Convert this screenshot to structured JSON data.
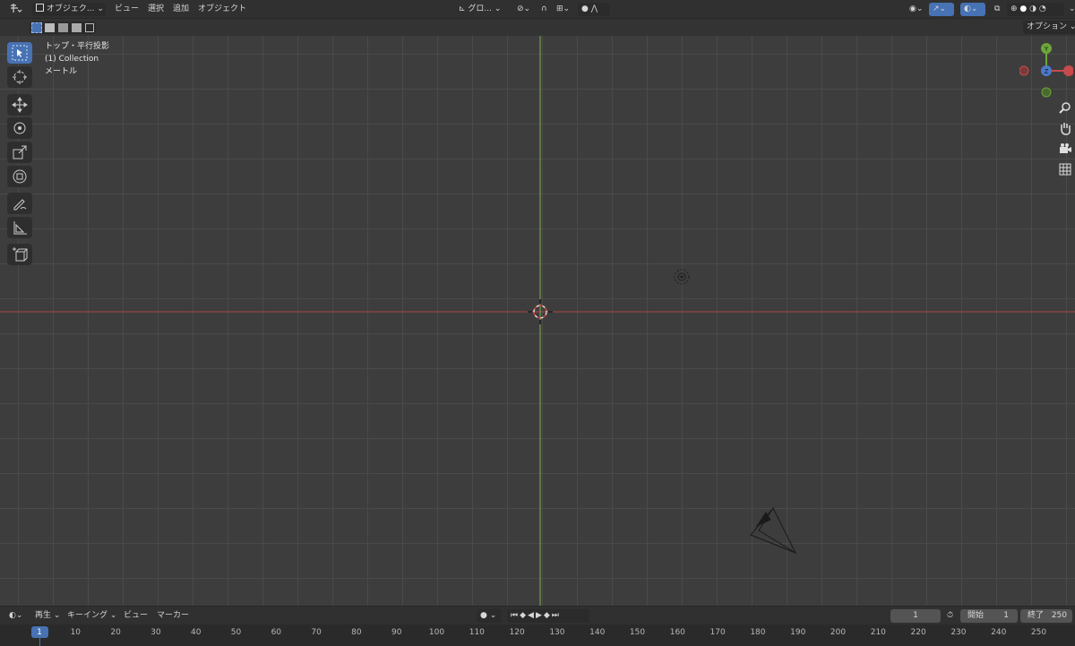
{
  "header": {
    "mode": "オブジェク...",
    "menu": [
      "ビュー",
      "選択",
      "追加",
      "オブジェクト"
    ],
    "orientation": "グロ...",
    "options": "オプション"
  },
  "viewport": {
    "info": [
      "トップ・平行投影",
      "(1) Collection",
      "メートル"
    ],
    "gizmo": {
      "y": "Y",
      "z": "Z"
    },
    "axis_colors": {
      "x": "#c94a4a",
      "y": "#6ca63a",
      "z": "#4a7ac9"
    }
  },
  "timeline": {
    "menu": [
      "再生",
      "キーイング",
      "ビュー",
      "マーカー"
    ],
    "current_frame": "1",
    "start_label": "開始",
    "start_value": "1",
    "end_label": "終了",
    "end_value": "250",
    "ruler_ticks": [
      "1",
      "10",
      "20",
      "30",
      "40",
      "50",
      "60",
      "70",
      "80",
      "90",
      "100",
      "110",
      "120",
      "130",
      "140",
      "150",
      "160",
      "170",
      "180",
      "190",
      "200",
      "210",
      "220",
      "230",
      "240",
      "250"
    ]
  }
}
